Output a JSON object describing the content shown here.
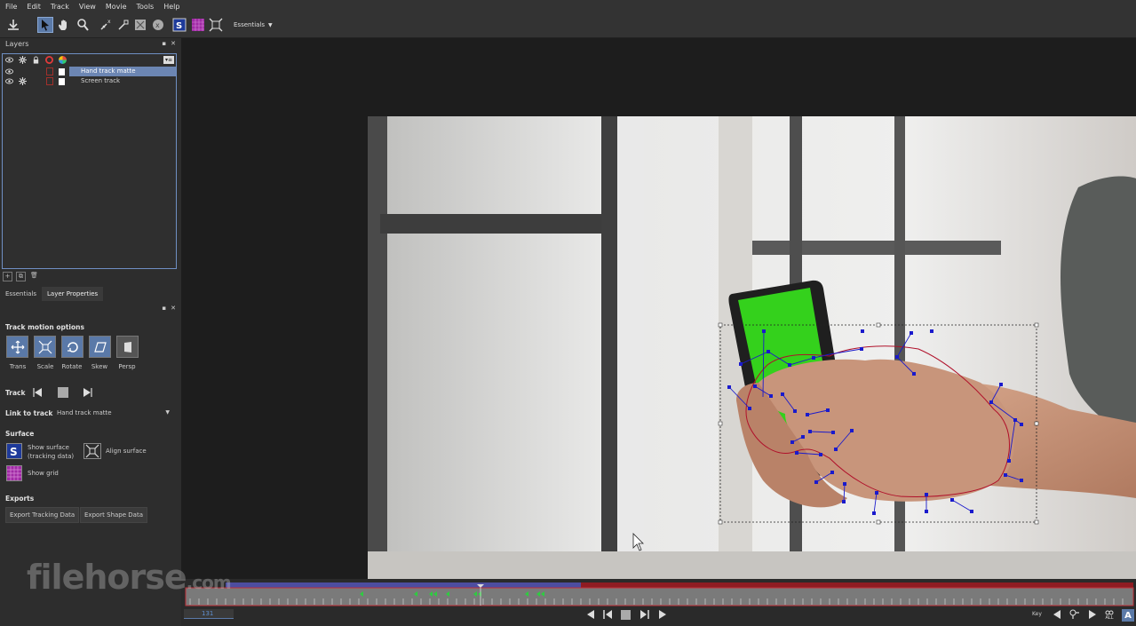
{
  "menu": [
    "File",
    "Edit",
    "Track",
    "View",
    "Movie",
    "Tools",
    "Help"
  ],
  "toolbar": {
    "workspace_label": "Essentials",
    "icons": [
      "save-icon",
      "select-icon",
      "hand-icon",
      "zoom-icon",
      "attach-point-icon",
      "link-icon",
      "track-matte-icon",
      "x-spline-icon",
      "surface-icon",
      "grid-icon",
      "align-surface-icon"
    ]
  },
  "layers_panel": {
    "title": "Layers",
    "layers": [
      {
        "name": "Hand track matte",
        "selected": true
      },
      {
        "name": "Screen track",
        "selected": false
      }
    ]
  },
  "tabs": [
    "Essentials",
    "Layer Properties"
  ],
  "track_motion": {
    "title": "Track motion options",
    "options": [
      {
        "label": "Trans",
        "on": true
      },
      {
        "label": "Scale",
        "on": true
      },
      {
        "label": "Rotate",
        "on": true
      },
      {
        "label": "Skew",
        "on": true
      },
      {
        "label": "Persp",
        "on": false
      }
    ]
  },
  "track": {
    "label": "Track"
  },
  "link_to_track": {
    "label": "Link to track",
    "value": "Hand track matte"
  },
  "surface": {
    "title": "Surface",
    "show_surface": "Show surface (tracking data)",
    "show_surface_line1": "Show surface",
    "show_surface_line2": "(tracking data)",
    "align_surface": "Align surface",
    "show_grid": "Show grid"
  },
  "exports": {
    "title": "Exports",
    "export_tracking": "Export Tracking Data",
    "export_shape": "Export Shape Data"
  },
  "timeline": {
    "current_frame": "131",
    "key_label": "Key",
    "all_label": "ALL"
  },
  "watermark": {
    "main": "filehorse",
    "suffix": ".com"
  },
  "colors": {
    "accent": "#5b7aa8",
    "track_blue": "#4d4da0",
    "track_red": "#8e1c22",
    "spline_blue": "#1a1acc",
    "spline_red": "#b0102a",
    "screen_green": "#34d11c"
  }
}
